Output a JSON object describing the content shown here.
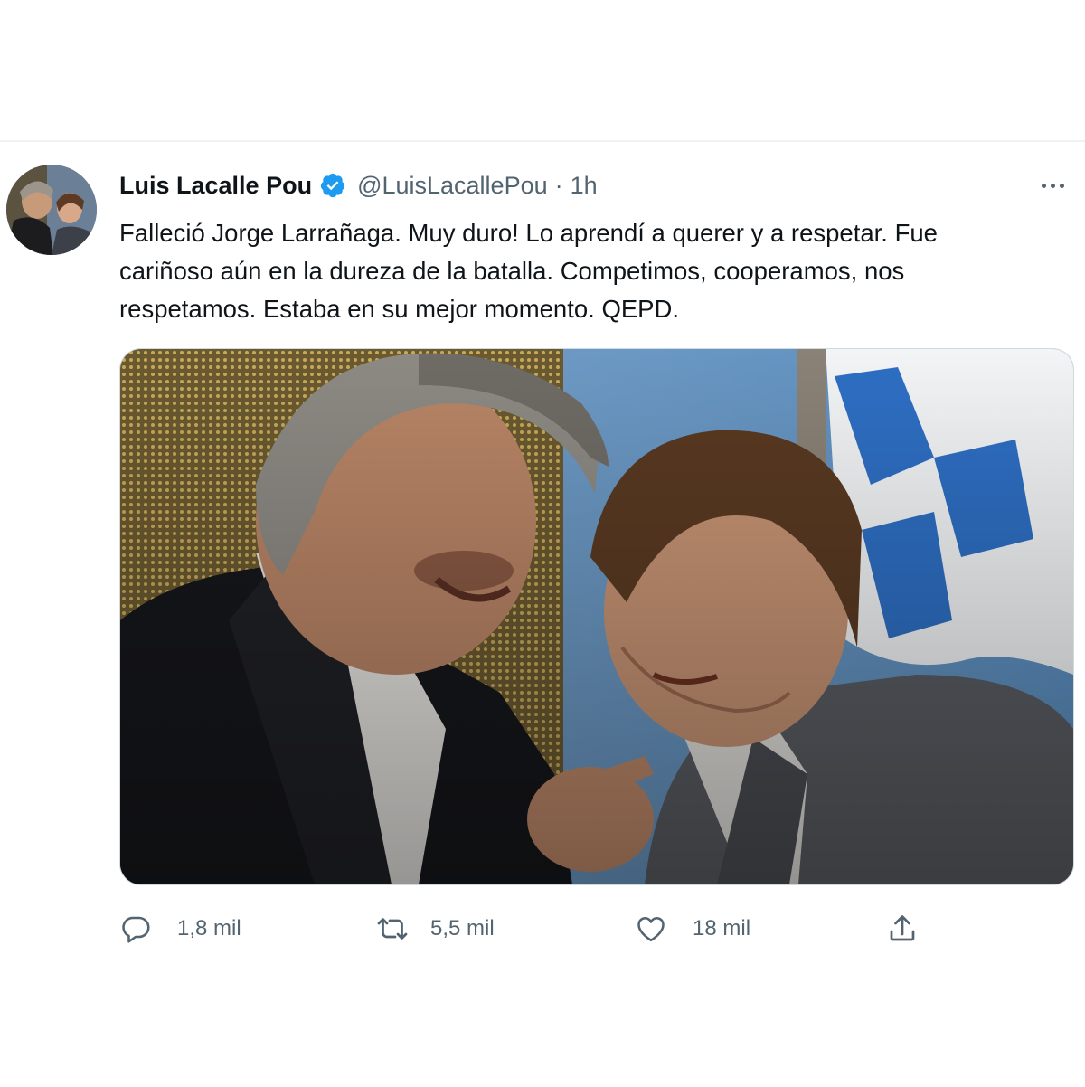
{
  "tweet": {
    "author_name": "Luis Lacalle Pou",
    "handle": "@LuisLacallePou",
    "separator": "·",
    "time": "1h",
    "text_lines": [
      "Falleció Jorge Larrañaga. Muy duro! Lo aprendí a querer y a respetar. Fue",
      "cariñoso aún en la dureza de la batalla. Competimos, cooperamos, nos",
      "respetamos. Estaba en su mejor momento. QEPD."
    ],
    "actions": {
      "replies": "1,8 mil",
      "retweets": "5,5 mil",
      "likes": "18 mil"
    }
  },
  "icons": {
    "verified": "verified-badge-icon",
    "more": "more-options-icon",
    "reply": "reply-icon",
    "retweet": "retweet-icon",
    "like": "heart-icon",
    "share": "share-icon"
  },
  "colors": {
    "text": "#0f1419",
    "secondary": "#536471",
    "verified": "#1d9bf0",
    "border": "#eff3f4"
  }
}
